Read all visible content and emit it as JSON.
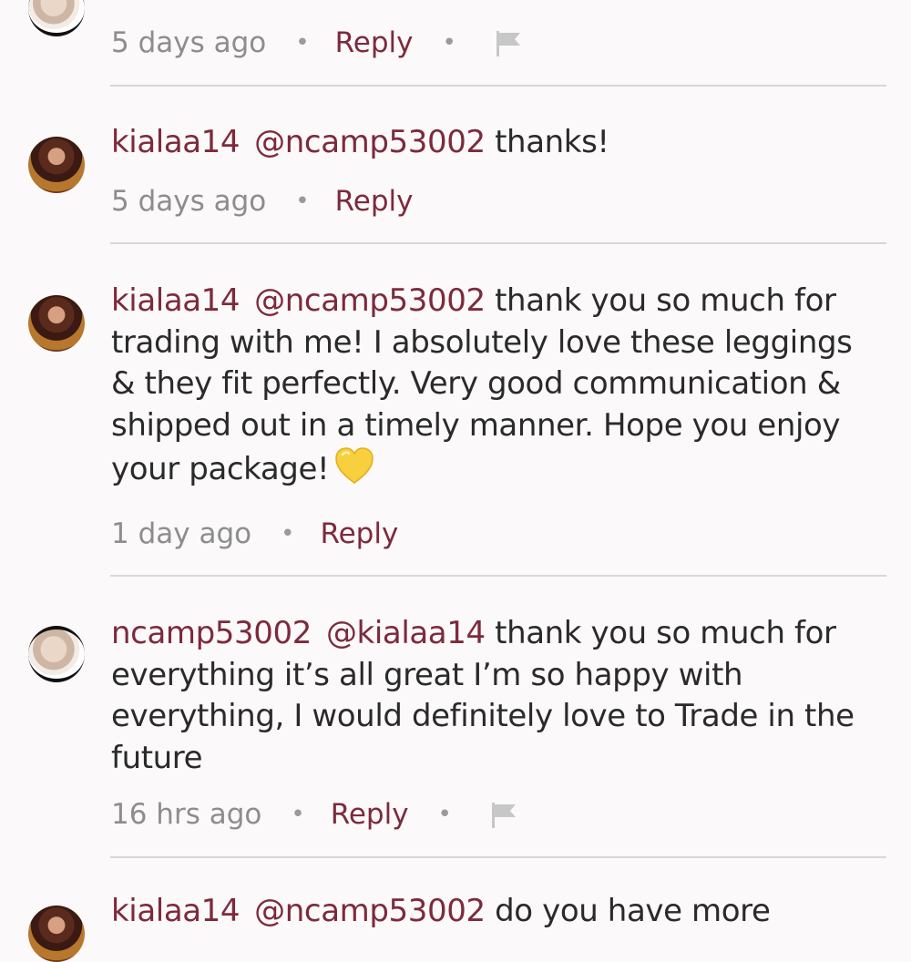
{
  "comments": [
    {
      "username": "",
      "mention": "",
      "text_lines": [],
      "time": "5 days ago",
      "reply_label": "Reply"
    },
    {
      "username": "kialaa14",
      "mention": "@ncamp53002",
      "text_lines": [
        "thanks!"
      ],
      "time": "5 days ago",
      "reply_label": "Reply"
    },
    {
      "username": "kialaa14",
      "mention": "@ncamp53002",
      "text_lines": [
        "thank you so much for",
        "trading with me! I absolutely love these leggings",
        "& they fit perfectly. Very good communication &",
        "shipped out in a timely manner. Hope you enjoy",
        "your package!"
      ],
      "emoji": "yellow-heart-icon",
      "time": "1 day ago",
      "reply_label": "Reply"
    },
    {
      "username": "ncamp53002",
      "mention": "@kialaa14",
      "text_lines": [
        "thank you so much for",
        "everything it’s all great I’m so happy with",
        "everything, I would definitely love to Trade in the",
        "future"
      ],
      "time": "16 hrs ago",
      "reply_label": "Reply"
    },
    {
      "username": "kialaa14",
      "mention": "@ncamp53002",
      "text_lines": [
        "do you have more"
      ],
      "time": "",
      "reply_label": ""
    }
  ],
  "colors": {
    "accent": "#7d2a3c",
    "meta": "#8d8d8d",
    "divider": "#d9d6d7",
    "background": "#fbf9fa"
  },
  "icons": {
    "flag": "flag-icon",
    "heart": "yellow-heart-icon"
  }
}
